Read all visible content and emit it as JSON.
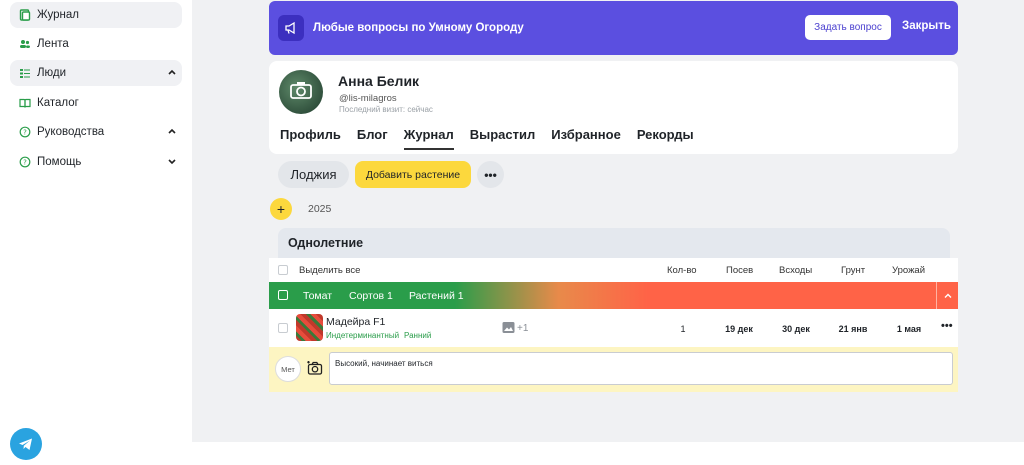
{
  "sidebar": {
    "items": [
      {
        "label": "Журнал",
        "icon": "journal-icon"
      },
      {
        "label": "Лента",
        "icon": "feed-icon"
      },
      {
        "label": "Люди",
        "icon": "people-icon"
      },
      {
        "label": "Каталог",
        "icon": "catalog-icon"
      },
      {
        "label": "Руководства",
        "icon": "help-circle-icon"
      },
      {
        "label": "Помощь",
        "icon": "help-circle-icon"
      }
    ]
  },
  "banner": {
    "text": "Любые вопросы по Умному Огороду",
    "ask_label": "Задать вопрос",
    "close_label": "Закрыть"
  },
  "profile": {
    "name": "Анна Белик",
    "handle": "@lis-milagros",
    "last_visit": "Последний визит: сейчас",
    "tabs": [
      "Профиль",
      "Блог",
      "Журнал",
      "Вырастил",
      "Избранное",
      "Рекорды"
    ],
    "active_tab": "Журнал"
  },
  "toolbar": {
    "room": "Лоджия",
    "add_plant": "Добавить растение",
    "more": "•••"
  },
  "year": {
    "plus": "+",
    "value": "2025"
  },
  "group": {
    "title": "Однолетние"
  },
  "table": {
    "select_all": "Выделить все",
    "columns": [
      "Кол-во",
      "Посев",
      "Всходы",
      "Грунт",
      "Урожай"
    ],
    "crop": {
      "name": "Томат",
      "varieties": "Сортов 1",
      "plants": "Растений 1"
    },
    "plant": {
      "name": "Мадейра F1",
      "tags": [
        "Индетерминантный",
        "Ранний"
      ],
      "photos_extra": "+1",
      "values": [
        "1",
        "19 дек",
        "30 дек",
        "21 янв",
        "1 мая"
      ],
      "more": "•••"
    },
    "note": {
      "met_label": "Мет",
      "text": "Высокий, начинает виться"
    }
  },
  "colors": {
    "banner": "#5b4fe0",
    "accent_yellow": "#fcd83d",
    "crop_green": "#2a9d4a",
    "crop_red": "#ff6347",
    "note_bg": "#fdf5c2"
  }
}
